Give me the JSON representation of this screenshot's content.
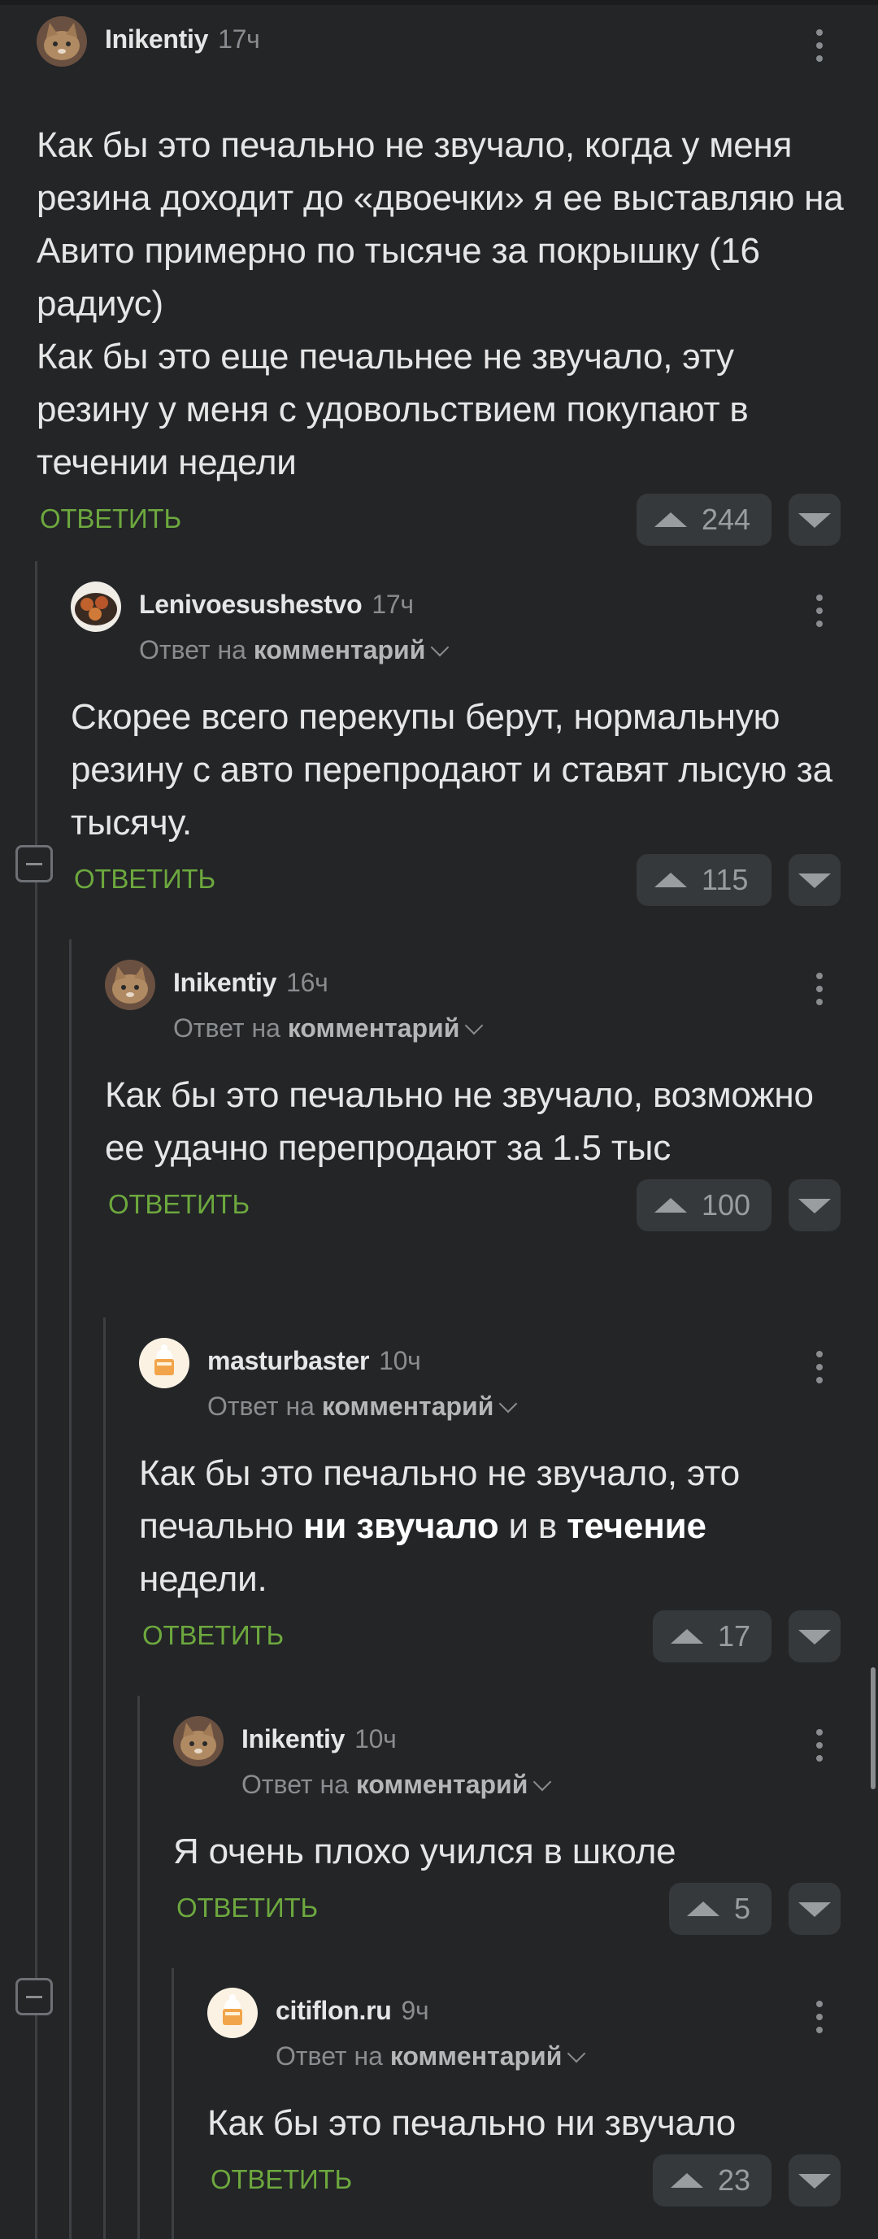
{
  "reply_label": "ОТВЕТИТЬ",
  "reply_to_prefix": "Ответ на",
  "reply_to_link": "комментарий",
  "comments": [
    {
      "author": "Inikentiy",
      "time": "17ч",
      "avatar": "cat-avatar",
      "text": "Как бы это печально не звучало, когда у меня резина доходит до «двоечки» я ее выставляю на Авито примерно по тысяче за покрышку (16 радиус)\nКак бы это еще печальнее не звучало, эту резину у меня с удовольствием покупают в течении недели",
      "rating": "244"
    },
    {
      "author": "Lenivoesushestvo",
      "time": "17ч",
      "avatar": "food-avatar",
      "text": "Скорее всего перекупы берут, нормальную резину с авто перепродают и ставят лысую за тысячу.",
      "rating": "115"
    },
    {
      "author": "Inikentiy",
      "time": "16ч",
      "avatar": "cat-avatar",
      "text": "Как бы это печально не звучало, возможно ее удачно перепродают за 1.5 тыс",
      "rating": "100"
    },
    {
      "author": "masturbaster",
      "time": "10ч",
      "avatar": "default-avatar",
      "text_parts": [
        "Как бы это печально не звучало, это печально ",
        "ни звучало",
        " и в ",
        "течение",
        " недели."
      ],
      "rating": "17"
    },
    {
      "author": "Inikentiy",
      "time": "10ч",
      "avatar": "cat-avatar",
      "text": "Я очень плохо учился в школе",
      "rating": "5"
    },
    {
      "author": "citiflon.ru",
      "time": "9ч",
      "avatar": "default-avatar",
      "text": "Как бы это печально ни звучало",
      "rating": "23"
    }
  ]
}
